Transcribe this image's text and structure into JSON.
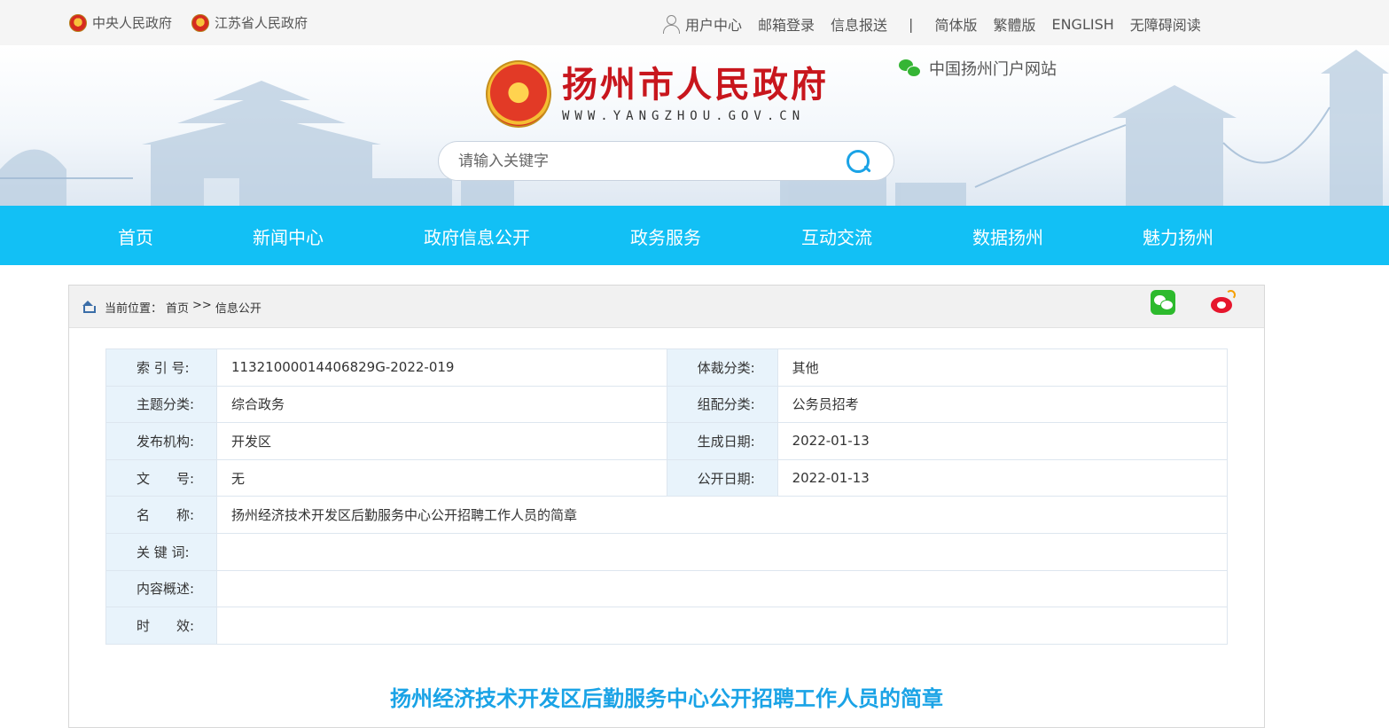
{
  "topbar": {
    "left_links": [
      "中央人民政府",
      "江苏省人民政府"
    ],
    "user_center": "用户中心",
    "right_links": [
      "邮箱登录",
      "信息报送"
    ],
    "separator": "|",
    "lang_links": [
      "简体版",
      "繁體版",
      "ENGLISH",
      "无障碍阅读"
    ]
  },
  "header": {
    "site_title": "扬州市人民政府",
    "site_url": "WWW.YANGZHOU.GOV.CN",
    "portal_label": "中国扬州门户网站",
    "search_placeholder": "请输入关键字"
  },
  "nav": {
    "items": [
      "首页",
      "新闻中心",
      "政府信息公开",
      "政务服务",
      "互动交流",
      "数据扬州",
      "魅力扬州"
    ]
  },
  "breadcrumb": {
    "prefix": "当前位置：",
    "home": "首页",
    "sep": ">>",
    "current": "信息公开"
  },
  "meta": {
    "index_label": "索 引 号:",
    "index_value": "11321000014406829G-2022-019",
    "genre_label": "体裁分类:",
    "genre_value": "其他",
    "topic_label": "主题分类:",
    "topic_value": "综合政务",
    "group_label": "组配分类:",
    "group_value": "公务员招考",
    "org_label": "发布机构:",
    "org_value": "开发区",
    "created_label": "生成日期:",
    "created_value": "2022-01-13",
    "docno_label": "文　　号:",
    "docno_value": "无",
    "published_label": "公开日期:",
    "published_value": "2022-01-13",
    "name_label": "名　　称:",
    "name_value": "扬州经济技术开发区后勤服务中心公开招聘工作人员的简章",
    "keywords_label": "关 键 词:",
    "keywords_value": "",
    "summary_label": "内容概述:",
    "summary_value": "",
    "validity_label": "时　　效:",
    "validity_value": ""
  },
  "document": {
    "title": "扬州经济技术开发区后勤服务中心公开招聘工作人员的简章"
  },
  "colors": {
    "nav_bg": "#12c0f5",
    "title_red": "#c8161d",
    "doc_title_blue": "#1aa3e6"
  }
}
